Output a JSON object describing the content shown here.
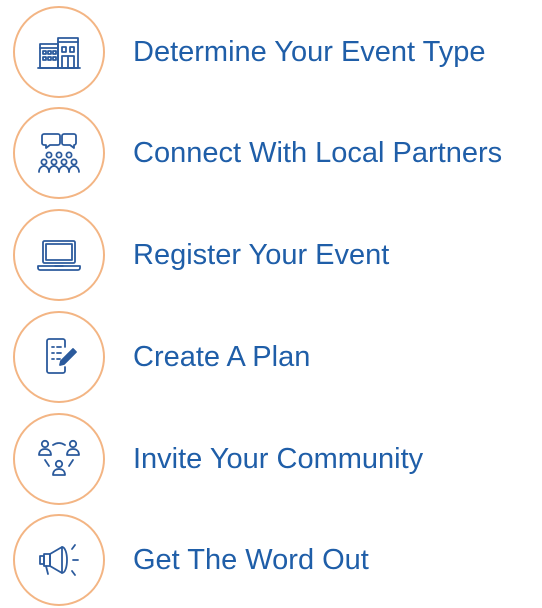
{
  "colors": {
    "accent_ring": "#f3b584",
    "icon": "#2b5a9c",
    "text": "#1f5ea8"
  },
  "steps": [
    {
      "icon": "buildings-icon",
      "label": "Determine Your Event Type"
    },
    {
      "icon": "community-chat-icon",
      "label": "Connect With Local Partners"
    },
    {
      "icon": "laptop-icon",
      "label": "Register Your Event"
    },
    {
      "icon": "document-edit-icon",
      "label": "Create A Plan"
    },
    {
      "icon": "people-network-icon",
      "label": "Invite Your Community"
    },
    {
      "icon": "megaphone-icon",
      "label": "Get The Word Out"
    }
  ]
}
